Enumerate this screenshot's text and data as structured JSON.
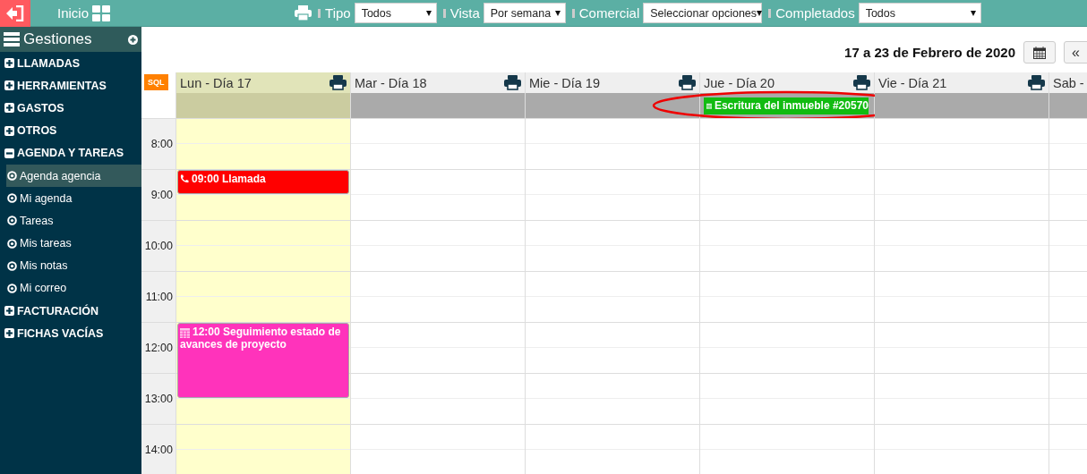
{
  "topbar": {
    "home_label": "Inicio",
    "filters": [
      {
        "label": "Tipo",
        "value": "Todos"
      },
      {
        "label": "Vista",
        "value": "Por semana"
      },
      {
        "label": "Comercial",
        "value": "Seleccionar opciones"
      },
      {
        "label": "Completados",
        "value": "Todos"
      }
    ]
  },
  "sidebar": {
    "title": "Gestiones",
    "items": [
      {
        "label": "LLAMADAS",
        "expanded": false
      },
      {
        "label": "HERRAMIENTAS",
        "expanded": false
      },
      {
        "label": "GASTOS",
        "expanded": false
      },
      {
        "label": "OTROS",
        "expanded": false
      },
      {
        "label": "AGENDA Y TAREAS",
        "expanded": true,
        "children": [
          {
            "label": "Agenda agencia",
            "selected": true
          },
          {
            "label": "Mi agenda",
            "selected": false
          },
          {
            "label": "Tareas",
            "selected": false
          },
          {
            "label": "Mis tareas",
            "selected": false
          },
          {
            "label": "Mis notas",
            "selected": false
          },
          {
            "label": "Mi correo",
            "selected": false
          }
        ]
      },
      {
        "label": "FACTURACIÓN",
        "expanded": false
      },
      {
        "label": "FICHAS VACÍAS",
        "expanded": false
      }
    ]
  },
  "calendar": {
    "range_title": "17 a 23 de Febrero de 2020",
    "prev_button": "«",
    "sql_badge": "SQL",
    "hours": [
      {
        "label": "8:00"
      },
      {
        "label": "9:00"
      },
      {
        "label": "10:00"
      },
      {
        "label": "11:00"
      },
      {
        "label": "12:00"
      },
      {
        "label": "13:00"
      },
      {
        "label": "14:00"
      }
    ],
    "days": [
      {
        "label": "Lun - Día 17",
        "selected": true,
        "partial": false,
        "events": [
          {
            "kind": "call",
            "time": "09:00",
            "title": "Llamada",
            "color": "#ff0000"
          },
          {
            "kind": "appointment",
            "time": "12:00",
            "title": "Seguimiento estado de avances de proyecto",
            "color": "#ff33bb"
          }
        ]
      },
      {
        "label": "Mar - Día 18",
        "selected": false,
        "partial": false
      },
      {
        "label": "Mie - Día 19",
        "selected": false,
        "partial": false
      },
      {
        "label": "Jue - Día 20",
        "selected": false,
        "partial": false,
        "all_day": [
          {
            "title": "Escritura del inmueble #20570",
            "circled": true,
            "color": "#11bb11"
          }
        ]
      },
      {
        "label": "Vie - Día 21",
        "selected": false,
        "partial": false
      },
      {
        "label": "Sab -",
        "selected": false,
        "partial": true
      }
    ]
  }
}
